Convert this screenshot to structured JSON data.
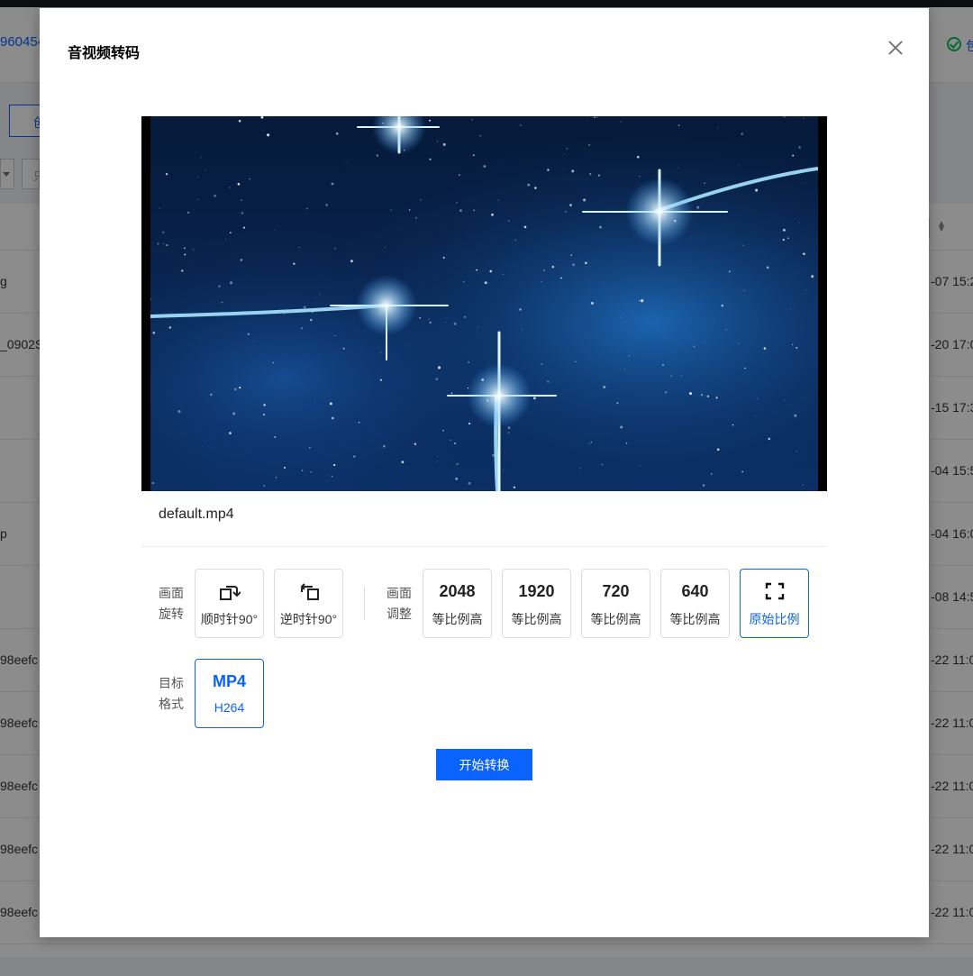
{
  "background": {
    "id_fragment": "960454",
    "status_fragment": "包",
    "button_fragment": "创",
    "input_fragment": "只",
    "rows": [
      {
        "name": "g",
        "time": "-07 15:2"
      },
      {
        "name": "_0902S",
        "time": "-20 17:0"
      },
      {
        "name": "",
        "time": "-15 17:3"
      },
      {
        "name": "",
        "time": "-04 15:5"
      },
      {
        "name": "p",
        "time": "-04 16:0"
      },
      {
        "name": "",
        "time": "-08 14:5"
      },
      {
        "name": "98eefc",
        "time": "-22 11:0"
      },
      {
        "name": "98eefc",
        "time": "-22 11:0"
      },
      {
        "name": "98eefc",
        "time": "-22 11:0"
      },
      {
        "name": "98eefc",
        "time": "-22 11:0"
      },
      {
        "name": "98eefc",
        "time": "-22 11:0"
      }
    ]
  },
  "modal": {
    "title": "音视频转码",
    "file_name": "default.mp4",
    "rotate": {
      "label_line1": "画面",
      "label_line2": "旋转",
      "options": [
        {
          "label": "顺时针90°",
          "icon": "rotate-clockwise-icon"
        },
        {
          "label": "逆时针90°",
          "icon": "rotate-counterclockwise-icon"
        }
      ]
    },
    "resize": {
      "label_line1": "画面",
      "label_line2": "调整",
      "options": [
        {
          "value": "2048",
          "label": "等比例高"
        },
        {
          "value": "1920",
          "label": "等比例高"
        },
        {
          "value": "720",
          "label": "等比例高"
        },
        {
          "value": "640",
          "label": "等比例高"
        },
        {
          "value": "",
          "label": "原始比例",
          "icon": "fullscreen-icon",
          "selected": true
        }
      ]
    },
    "format": {
      "label_line1": "目标",
      "label_line2": "格式",
      "options": [
        {
          "value": "MP4",
          "label": "H264",
          "selected": true
        }
      ]
    },
    "start_button": "开始转换"
  },
  "colors": {
    "accent": "#0a63ff",
    "success": "#0abf5b"
  }
}
